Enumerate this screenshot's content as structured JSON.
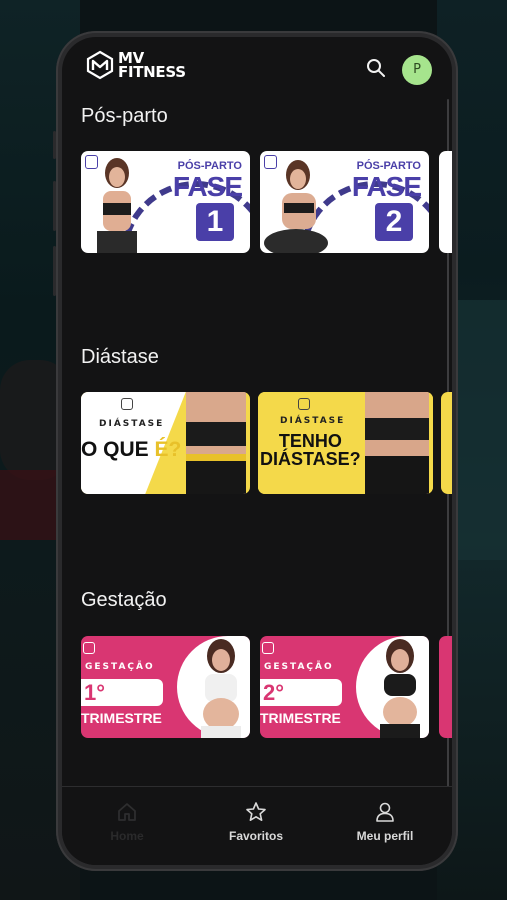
{
  "app": {
    "logo_line1": "MV",
    "logo_line2": "FITNESS",
    "avatar_initial": "P"
  },
  "sections": [
    {
      "title": "Pós-parto",
      "cards": [
        {
          "kicker": "PÓS-PARTO",
          "title": "FASE",
          "number": "1"
        },
        {
          "kicker": "PÓS-PARTO",
          "title": "FASE",
          "number": "2"
        }
      ]
    },
    {
      "title": "Diástase",
      "cards": [
        {
          "kicker": "DIÁSTASE",
          "title_a": "O QUE ",
          "title_b": "É?"
        },
        {
          "kicker": "DIÁSTASE",
          "title_line1": "TENHO",
          "title_line2": "DIÁSTASE?"
        }
      ]
    },
    {
      "title": "Gestação",
      "cards": [
        {
          "kicker": "GESTAÇÃO",
          "number": "1°",
          "subtitle": "TRIMESTRE"
        },
        {
          "kicker": "GESTAÇÃO",
          "number": "2°",
          "subtitle": "TRIMESTRE"
        }
      ]
    }
  ],
  "nav": {
    "items": [
      {
        "label": "Home",
        "icon": "home-icon",
        "active": false
      },
      {
        "label": "Favoritos",
        "icon": "star-icon",
        "active": true
      },
      {
        "label": "Meu perfil",
        "icon": "user-icon",
        "active": true
      }
    ]
  },
  "colors": {
    "background": "#131314",
    "avatar": "#a6e48d",
    "posparto_accent": "#4a3fa8",
    "diastase_accent": "#f4d94a",
    "gestacao_accent": "#d93672"
  }
}
